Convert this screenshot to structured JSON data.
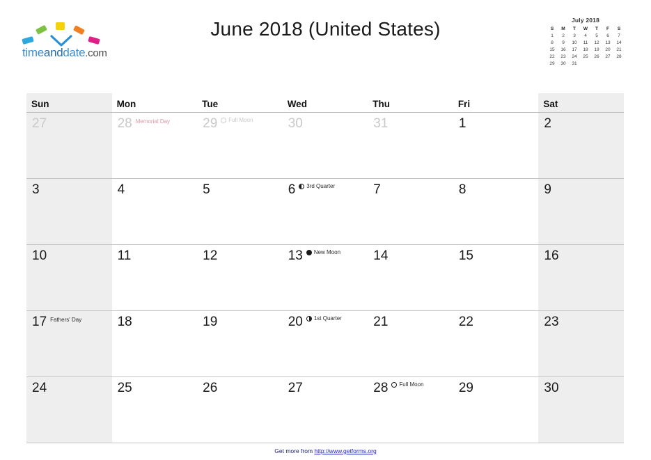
{
  "brand": {
    "name_time": "time",
    "name_and": "and",
    "name_date": "date",
    "name_com": ".com",
    "colors": [
      "#5ab0e0",
      "#7cc142",
      "#f5d10a",
      "#f08020",
      "#e0218a"
    ]
  },
  "header": {
    "title": "June 2018 (United States)"
  },
  "mini_month": {
    "title": "July 2018",
    "weekdays": [
      "S",
      "M",
      "T",
      "W",
      "T",
      "F",
      "S"
    ],
    "weeks": [
      [
        "1",
        "2",
        "3",
        "4",
        "5",
        "6",
        "7"
      ],
      [
        "8",
        "9",
        "10",
        "11",
        "12",
        "13",
        "14"
      ],
      [
        "15",
        "16",
        "17",
        "18",
        "19",
        "20",
        "21"
      ],
      [
        "22",
        "23",
        "24",
        "25",
        "26",
        "27",
        "28"
      ],
      [
        "29",
        "30",
        "31",
        "",
        "",
        "",
        ""
      ]
    ]
  },
  "calendar": {
    "weekdays": [
      "Sun",
      "Mon",
      "Tue",
      "Wed",
      "Thu",
      "Fri",
      "Sat"
    ],
    "weeks": [
      [
        {
          "day": "27",
          "other": true,
          "event": "",
          "moon": ""
        },
        {
          "day": "28",
          "other": true,
          "event": "Memorial Day",
          "event_style": "holiday-prev",
          "moon": ""
        },
        {
          "day": "29",
          "other": true,
          "event": "Full Moon",
          "event_style": "moon-prev",
          "moon": "full",
          "moon_faded": true
        },
        {
          "day": "30",
          "other": true,
          "event": "",
          "moon": ""
        },
        {
          "day": "31",
          "other": true,
          "event": "",
          "moon": ""
        },
        {
          "day": "1",
          "other": false,
          "event": "",
          "moon": ""
        },
        {
          "day": "2",
          "other": false,
          "event": "",
          "moon": ""
        }
      ],
      [
        {
          "day": "3",
          "other": false,
          "event": "",
          "moon": ""
        },
        {
          "day": "4",
          "other": false,
          "event": "",
          "moon": ""
        },
        {
          "day": "5",
          "other": false,
          "event": "",
          "moon": ""
        },
        {
          "day": "6",
          "other": false,
          "event": "3rd Quarter",
          "moon": "third"
        },
        {
          "day": "7",
          "other": false,
          "event": "",
          "moon": ""
        },
        {
          "day": "8",
          "other": false,
          "event": "",
          "moon": ""
        },
        {
          "day": "9",
          "other": false,
          "event": "",
          "moon": ""
        }
      ],
      [
        {
          "day": "10",
          "other": false,
          "event": "",
          "moon": ""
        },
        {
          "day": "11",
          "other": false,
          "event": "",
          "moon": ""
        },
        {
          "day": "12",
          "other": false,
          "event": "",
          "moon": ""
        },
        {
          "day": "13",
          "other": false,
          "event": "New Moon",
          "moon": "new"
        },
        {
          "day": "14",
          "other": false,
          "event": "",
          "moon": ""
        },
        {
          "day": "15",
          "other": false,
          "event": "",
          "moon": ""
        },
        {
          "day": "16",
          "other": false,
          "event": "",
          "moon": ""
        }
      ],
      [
        {
          "day": "17",
          "other": false,
          "event": "Fathers' Day",
          "moon": ""
        },
        {
          "day": "18",
          "other": false,
          "event": "",
          "moon": ""
        },
        {
          "day": "19",
          "other": false,
          "event": "",
          "moon": ""
        },
        {
          "day": "20",
          "other": false,
          "event": "1st Quarter",
          "moon": "first"
        },
        {
          "day": "21",
          "other": false,
          "event": "",
          "moon": ""
        },
        {
          "day": "22",
          "other": false,
          "event": "",
          "moon": ""
        },
        {
          "day": "23",
          "other": false,
          "event": "",
          "moon": ""
        }
      ],
      [
        {
          "day": "24",
          "other": false,
          "event": "",
          "moon": ""
        },
        {
          "day": "25",
          "other": false,
          "event": "",
          "moon": ""
        },
        {
          "day": "26",
          "other": false,
          "event": "",
          "moon": ""
        },
        {
          "day": "27",
          "other": false,
          "event": "",
          "moon": ""
        },
        {
          "day": "28",
          "other": false,
          "event": "Full Moon",
          "moon": "full"
        },
        {
          "day": "29",
          "other": false,
          "event": "",
          "moon": ""
        },
        {
          "day": "30",
          "other": false,
          "event": "",
          "moon": ""
        }
      ]
    ]
  },
  "footer": {
    "prefix": "Get more from ",
    "url": "http://www.getforms.org"
  }
}
